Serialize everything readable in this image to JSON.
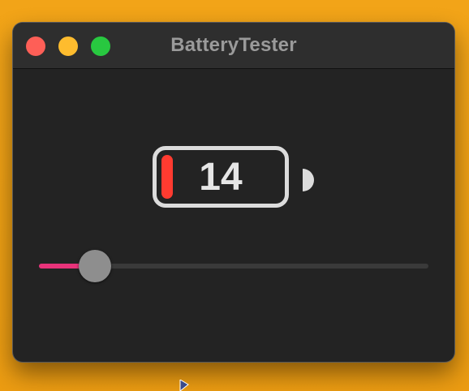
{
  "window": {
    "title": "BatteryTester",
    "controls": [
      "close",
      "minimize",
      "zoom"
    ]
  },
  "battery": {
    "value_text": "14",
    "level_fraction": 0.14,
    "fill_color": "#ff3b30",
    "icon": "battery-icon"
  },
  "slider": {
    "value_fraction": 0.14,
    "fill_color": "#e8337a",
    "track_color": "#3a3a3a",
    "thumb_color": "#8e8e8e"
  },
  "colors": {
    "desktop": "#f2a418",
    "window_bg": "#232323",
    "titlebar_bg": "#2e2e2e",
    "close": "#fe5f57",
    "minimize": "#febc2e",
    "zoom": "#28c840"
  }
}
